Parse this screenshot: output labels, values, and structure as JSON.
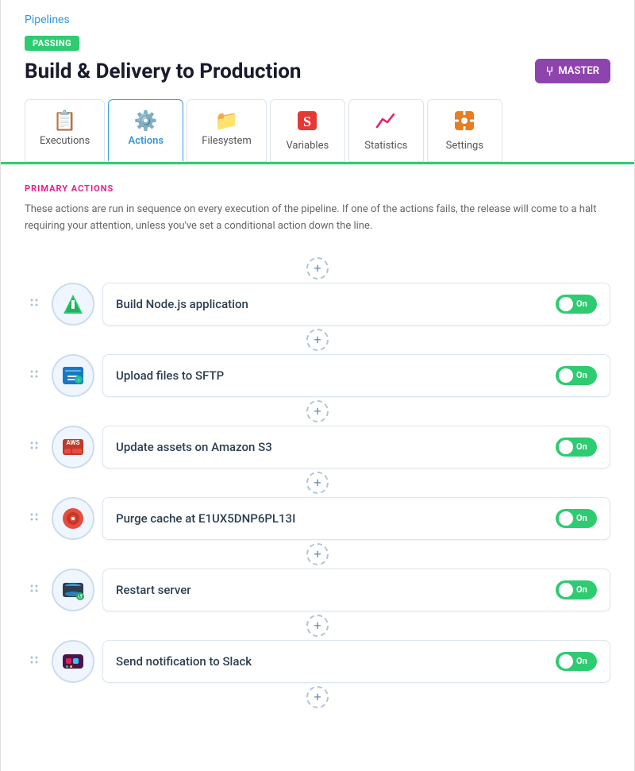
{
  "nav": {
    "pipelines_label": "Pipelines"
  },
  "status": {
    "badge_label": "PASSING"
  },
  "pipeline": {
    "title": "Build & Delivery to Production",
    "branch_label": "MASTER"
  },
  "tabs": [
    {
      "id": "executions",
      "label": "Executions",
      "icon": "📋",
      "active": false
    },
    {
      "id": "actions",
      "label": "Actions",
      "icon": "⚙️",
      "active": true
    },
    {
      "id": "filesystem",
      "label": "Filesystem",
      "icon": "📁",
      "active": false
    },
    {
      "id": "variables",
      "label": "Variables",
      "icon": "🅂",
      "active": false
    },
    {
      "id": "statistics",
      "label": "Statistics",
      "icon": "📈",
      "active": false
    },
    {
      "id": "settings",
      "label": "Settings",
      "icon": "🔧",
      "active": false
    }
  ],
  "primary_actions": {
    "section_label": "PRIMARY ACTIONS",
    "description": "These actions are run in sequence on every execution of the pipeline. If one of the actions fails, the release will come to a halt requiring your attention, unless you've set a conditional action down the line.",
    "items": [
      {
        "label": "Build Node.js application",
        "icon": "🟢",
        "toggle": "On",
        "enabled": true
      },
      {
        "label": "Upload files to SFTP",
        "icon": "💻",
        "toggle": "On",
        "enabled": true
      },
      {
        "label": "Update assets on Amazon S3",
        "icon": "🟥",
        "toggle": "On",
        "enabled": true
      },
      {
        "label": "Purge cache at E1UX5DNP6PL13I",
        "icon": "🔴",
        "toggle": "On",
        "enabled": true
      },
      {
        "label": "Restart server",
        "icon": "🌐",
        "toggle": "On",
        "enabled": true
      },
      {
        "label": "Send notification to Slack",
        "icon": "💬",
        "toggle": "On",
        "enabled": true
      }
    ]
  },
  "icons": {
    "drag": "÷",
    "add": "+",
    "branch": "⑂"
  }
}
